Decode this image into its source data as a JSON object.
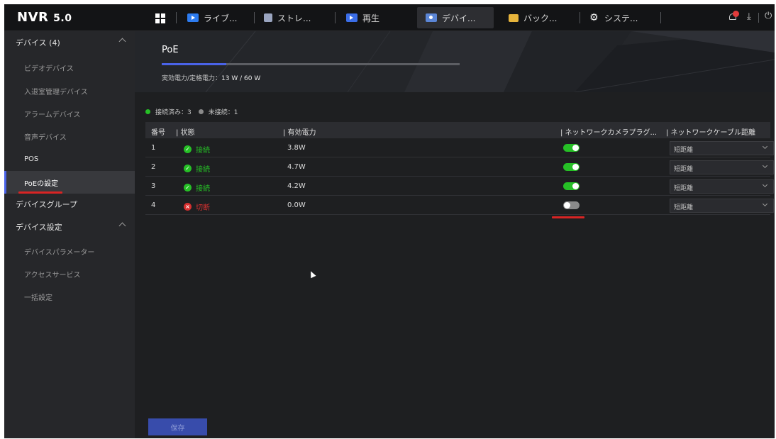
{
  "app": {
    "logo_main": "NVR",
    "logo_version": "5.0"
  },
  "topbar": {
    "tabs": [
      {
        "label": "ライブ...",
        "icon": "live-view-icon"
      },
      {
        "label": "ストレ...",
        "icon": "storage-icon"
      },
      {
        "label": "再生",
        "icon": "playback-icon"
      },
      {
        "label": "デバイ...",
        "icon": "device-icon",
        "active": true
      },
      {
        "label": "バック...",
        "icon": "backup-icon"
      },
      {
        "label": "システ...",
        "icon": "system-gear-icon"
      }
    ],
    "notification_badge": "",
    "icons": [
      "home-grid-icon",
      "bell-icon",
      "download-icon",
      "power-icon"
    ]
  },
  "sidebar": {
    "devices_group": "デバイス (4)",
    "items": [
      {
        "label": "ビデオデバイス"
      },
      {
        "label": "入退室管理デバイス"
      },
      {
        "label": "アラームデバイス"
      },
      {
        "label": "音声デバイス"
      },
      {
        "label": "POS"
      },
      {
        "label": "PoEの設定",
        "active": true
      }
    ],
    "device_group_label": "デバイスグループ",
    "device_settings_group": "デバイス設定",
    "settings_items": [
      {
        "label": "デバイスパラメーター"
      },
      {
        "label": "アクセスサービス"
      },
      {
        "label": "一括設定"
      }
    ]
  },
  "poe": {
    "title": "PoE",
    "power_label": "実効電力/定格電力：",
    "power_value": "13 W / 60 W",
    "power_used_fraction": 0.217,
    "connected_label": "接続済み：3",
    "disconnected_label": "未接続：1"
  },
  "table": {
    "headers": {
      "no": "番号",
      "status": "| 状態",
      "power": "| 有効電力",
      "plug": "| ネットワークカメラプラグ...",
      "distance": "| ネットワークケーブル距離"
    },
    "rows": [
      {
        "no": "1",
        "status": "接続",
        "connected": true,
        "power": "3.8W",
        "plug_on": true,
        "distance": "短距離"
      },
      {
        "no": "2",
        "status": "接続",
        "connected": true,
        "power": "4.7W",
        "plug_on": true,
        "distance": "短距離"
      },
      {
        "no": "3",
        "status": "接続",
        "connected": true,
        "power": "4.2W",
        "plug_on": true,
        "distance": "短距離"
      },
      {
        "no": "4",
        "status": "切断",
        "connected": false,
        "power": "0.0W",
        "plug_on": false,
        "distance": "短距離"
      }
    ]
  },
  "actions": {
    "save": "保存"
  },
  "colors": {
    "accent": "#4a63e8",
    "connected": "#26c026",
    "disconnected": "#d83030",
    "annotation_red": "#d82424"
  }
}
